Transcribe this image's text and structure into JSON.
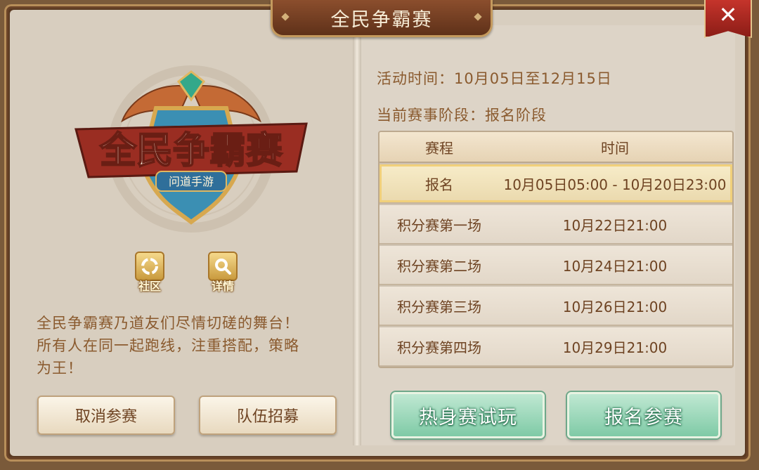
{
  "dialog": {
    "title": "全民争霸赛",
    "close_label": "✕"
  },
  "left": {
    "logo_title": "全民争霸赛",
    "logo_subtitle": "问道手游",
    "community_label": "社区",
    "details_label": "详情",
    "description_line1": "全民争霸赛乃道友们尽情切磋的舞台！",
    "description_line2": "所有人在同一起跑线，注重搭配，策略",
    "description_line3": "为王！",
    "cancel_button": "取消参赛",
    "team_button": "队伍招募"
  },
  "right": {
    "activity_time": "活动时间：10月05日至12月15日",
    "current_stage": "当前赛事阶段：报名阶段",
    "table": {
      "headers": [
        "赛程",
        "时间"
      ],
      "rows": [
        {
          "stage": "报名",
          "time": "10月05日05:00 - 10月20日23:00",
          "highlighted": true
        },
        {
          "stage": "积分赛第一场",
          "time": "10月22日21:00",
          "highlighted": false
        },
        {
          "stage": "积分赛第二场",
          "time": "10月24日21:00",
          "highlighted": false
        },
        {
          "stage": "积分赛第三场",
          "time": "10月26日21:00",
          "highlighted": false
        },
        {
          "stage": "积分赛第四场",
          "time": "10月29日21:00",
          "highlighted": false
        }
      ]
    },
    "warmup_button": "热身赛试玩",
    "signup_button": "报名参赛"
  },
  "colors": {
    "text_brown": "#8a5a2e",
    "title_bar": "#6f3a1f",
    "close_red": "#b02a22",
    "green_button": "#8fd3b0",
    "highlight_row": "#f1d07a"
  }
}
